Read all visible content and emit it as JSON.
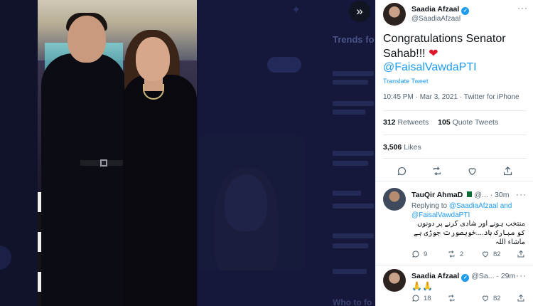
{
  "background": {
    "trends_heading": "Trends fo",
    "who_to_follow": "Who to fo"
  },
  "overlay": {
    "collapse_icon": "double-chevron-right-icon"
  },
  "tweet": {
    "author_name": "Saadia Afzaal",
    "author_handle": "@SaadiaAfzaal",
    "text": "Congratulations Senator Sahab!!!",
    "emoji": "❤",
    "mention": "@FaisalVawdaPTI",
    "translate": "Translate Tweet",
    "timestamp": "10:45 PM · Mar 3, 2021 · Twitter for iPhone",
    "retweets": "312",
    "retweets_label": "Retweets",
    "quote_tweets": "105",
    "quote_tweets_label": "Quote Tweets",
    "likes": "3,506",
    "likes_label": "Likes"
  },
  "replies": [
    {
      "name": "TauQir AhmaD",
      "meta": "@...",
      "time": "· 30m",
      "replying_prefix": "Replying to",
      "replying_to_1": "@SaadiaAfzaal",
      "replying_and": "and",
      "replying_to_2": "@FaisalVawdaPTI",
      "text_line1": "منتخب ہونے اور شادی کرنے پر دونوں",
      "text_line2": "کو مبارک باد....خوبصورت جوڑی ہے",
      "text_line3": "ماشاء اللہ",
      "reply_count": "9",
      "retweet_count": "2",
      "like_count": "82"
    },
    {
      "name": "Saadia Afzaal",
      "meta": "@Sa...",
      "time": "· 29m",
      "text": "🙏🙏",
      "reply_count": "18",
      "retweet_count": "",
      "like_count": "82"
    }
  ],
  "colors": {
    "accent": "#1d9bf0",
    "heart": "#e0162b",
    "muted": "#536471"
  }
}
